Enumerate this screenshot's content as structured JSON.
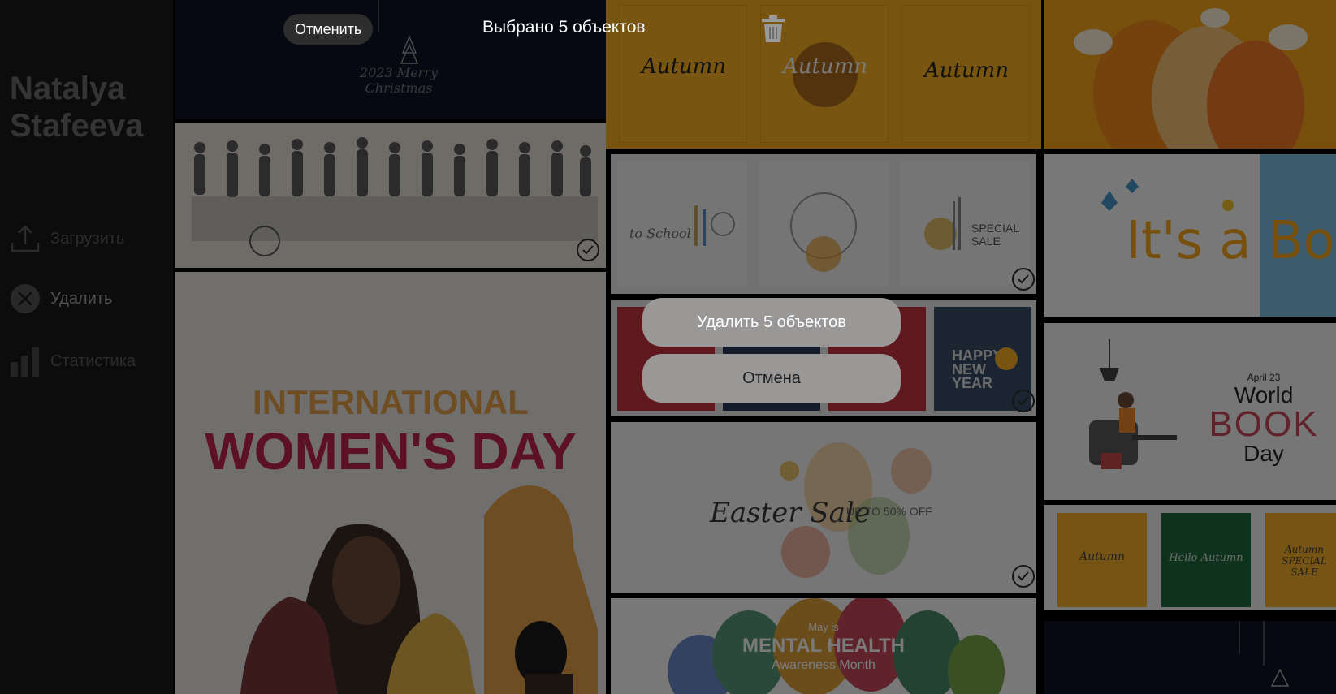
{
  "sidebar": {
    "name_line1": "Natalya",
    "name_line2": "Stafeeva",
    "items": [
      {
        "label": "Загрузить",
        "icon": "upload-icon"
      },
      {
        "label": "Удалить",
        "icon": "close-circle-icon"
      },
      {
        "label": "Статистика",
        "icon": "bar-chart-icon"
      }
    ]
  },
  "topbar": {
    "cancel_label": "Отменить",
    "selection_text": "Выбрано 5 объектов",
    "delete_icon": "trash-icon"
  },
  "dialog": {
    "delete_label": "Удалить 5 объектов",
    "cancel_label": "Отмена"
  },
  "tiles": {
    "christmas": "2023 Merry Christmas",
    "autumn": "Autumn",
    "back_to_school": "to School",
    "special_sale": "SPECIAL SALE",
    "happy_new_year": "HAPPY NEW YEAR",
    "womens_day_line1": "INTERNATIONAL",
    "womens_day_line2": "WOMEN'S DAY",
    "easter_sale": "Easter Sale",
    "easter_discount": "UP TO 50% OFF",
    "mental_health_date": "May is",
    "mental_health_title": "MENTAL HEALTH",
    "mental_health_sub": "Awareness Month",
    "its_a_boy": "It's a Bo",
    "world_book_date": "April 23",
    "world_book_title_1": "World",
    "world_book_title_2": "BOOK",
    "world_book_title_3": "Day",
    "hello_autumn": "Hello Autumn",
    "autumn_sale": "Autumn SPECIAL SALE"
  },
  "colors": {
    "sidebar_bg": "#1a1a1a",
    "accent_orange": "#f7b21a",
    "dialog_button": "#9a9797"
  }
}
